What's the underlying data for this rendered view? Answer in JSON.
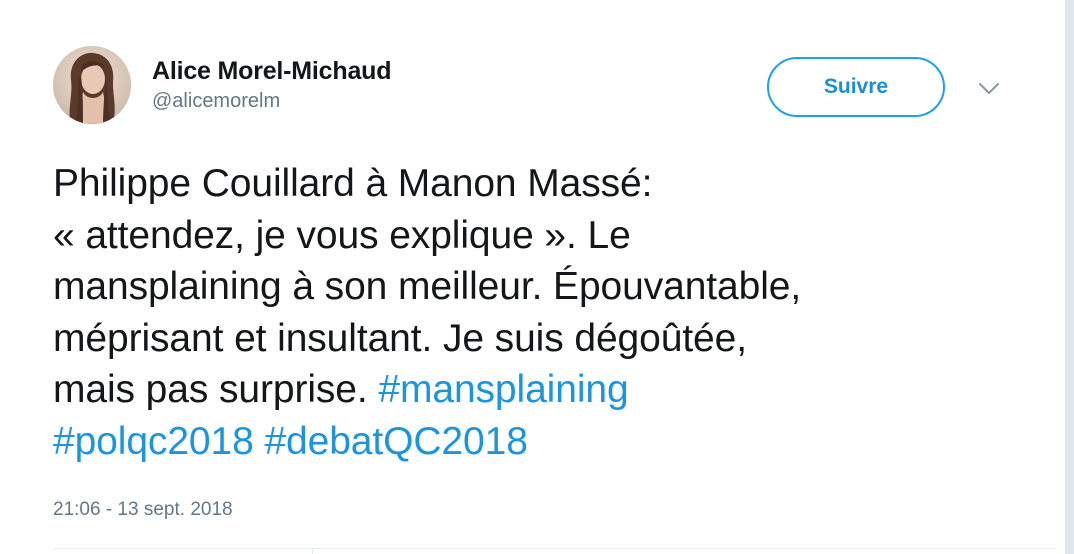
{
  "tweet": {
    "author": {
      "name": "Alice Morel-Michaud",
      "handle": "@alicemorelm"
    },
    "follow_label": "Suivre",
    "text": {
      "segments": [
        {
          "type": "text",
          "value": "Philippe Couillard à Manon Massé:"
        },
        {
          "type": "text",
          "value": "« attendez, je vous explique ». Le"
        },
        {
          "type": "text",
          "value": "mansplaining à son meilleur. Épouvantable,"
        },
        {
          "type": "text",
          "value": "méprisant et insultant. Je suis dégoûtée,"
        },
        {
          "type": "text",
          "value": "mais pas surprise. "
        },
        {
          "type": "hashtag",
          "value": "#mansplaining"
        },
        {
          "type": "hashtag",
          "value": "#polqc2018"
        },
        {
          "type": "hashtag",
          "value": "#debatQC2018"
        }
      ]
    },
    "timestamp": "21:06 - 13 sept. 2018"
  },
  "colors": {
    "link": "#1b95e0",
    "follow_border": "#1da1f2",
    "text": "#14171a",
    "secondary": "#657786"
  },
  "icons": {
    "menu": "chevron-down-icon"
  }
}
